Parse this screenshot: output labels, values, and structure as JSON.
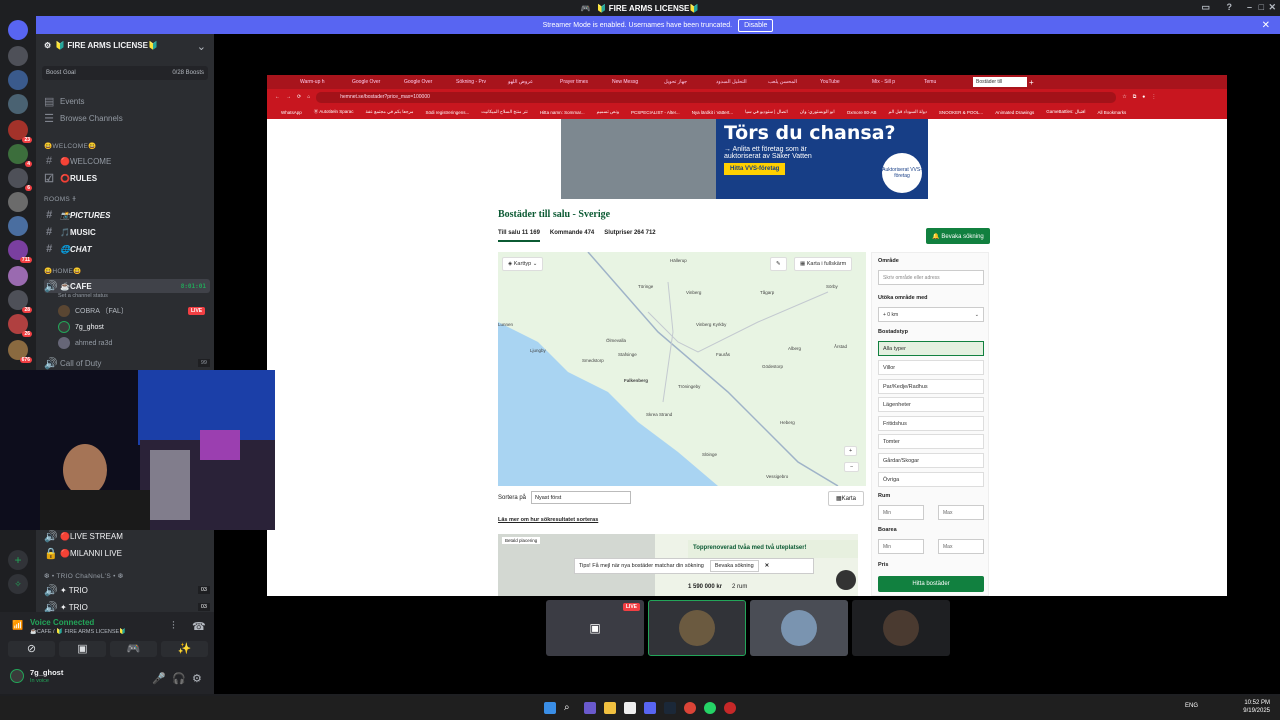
{
  "window": {
    "title": "🔰 FIRE ARMS LICENSE🔰"
  },
  "notice": {
    "text": "Streamer Mode is enabled. Usernames have been truncated.",
    "button": "Disable"
  },
  "rail": {
    "badges": [
      "23",
      "4",
      "6",
      "711",
      "676",
      "28",
      "26"
    ]
  },
  "sidebar": {
    "server_name": "🔰 FIRE ARMS LICENSE🔰",
    "boost_goal": "Boost Goal",
    "boosts": "0/28 Boosts",
    "events": "Events",
    "browse": "Browse Channels",
    "cat_welcome": "😃WELCOME😃",
    "welcome": "🔴WELCOME",
    "rules": "⭕RULES",
    "cat_rooms": "ROOMS 🕇",
    "pictures": "📸PICTURES",
    "music": "🎵MUSIC",
    "chat": "🌐CHAT",
    "cat_home": "😃HOME😃",
    "cafe": "☕CAFE",
    "cafe_time": "8:01:01",
    "cafe_status": "Set a channel status",
    "user1": "COBRA 〔FAL〕",
    "user1_badge": "LIVE",
    "user2": "7g_ghost",
    "user3": "ahmed ra3d",
    "callofduty": "Call of Duty",
    "callofduty_count": "99",
    "livestream": "🔴LIVE STREAM",
    "milanni": "🔴MILANNI LIVE",
    "cat_trio": "❆ • TRIO ChaNneL'S • ❆",
    "trio1": "✦ TRIO",
    "trio1_count": "03",
    "trio2": "✦ TRIO",
    "trio2_count": "03"
  },
  "voice": {
    "status": "Voice Connected",
    "location": "☕CAFE / 🔰 FIRE ARMS LICENSE🔰",
    "username": "7g_ghost",
    "substatus": "In voice"
  },
  "browser": {
    "tabs": [
      "Warm-up h",
      "Google Over",
      "Google Over",
      "Sökning - Prv",
      "عروض اللهو",
      "Prayer times",
      "New Messg",
      "جهاز تحويل",
      "التحليل السدود",
      "المحسن يلعب",
      "YouTube",
      "Mix - Sill p",
      "Temu",
      "Bostäder till"
    ],
    "url": "hemnet.se/bostader?price_max=100000",
    "bookmarks": [
      "WhatsApp",
      "Ⓡ Autotiteln Sparac",
      "مرجعا بكم في مجتمع عفة",
      "Södi registreringens...",
      "نتر منتخ السلاح الميكانيت",
      "Hitta namn: Sommar...",
      "ونص تسميم",
      "PCSPECIALIST - Alter...",
      "Nya lärdkit i Vattert...",
      "اتصال | ستوديو في سيا",
      "ابو الوبستوري: وان",
      "Oxmore 80-AB",
      "دولة السوداد قبل الم",
      "SNOOKER & POOL...",
      "Animated Drawings",
      "GameBattles: اقتبال",
      "All Bookmarks"
    ]
  },
  "ad": {
    "headline": "Törs du chansa?",
    "line1": "→ Anlita ett företag som är",
    "line2": "auktoriserat av Säker Vatten",
    "cta": "Hitta VVS-företag",
    "logo": "Auktoriserat VVS-företag"
  },
  "page": {
    "heading": "Bostäder till salu - Sverige",
    "tab_sale": "Till salu 11 169",
    "tab_coming": "Kommande 474",
    "tab_sold": "Slutpriser 264 712",
    "save_search": "🔔 Bevaka sökning",
    "map_type": "Karttyp",
    "map_fullscreen": "Karta i fullskärm",
    "sort_label": "Sortera på",
    "sort_value": "Nyast först",
    "map_button": "Karta",
    "learn_more": "Läs mer om hur sökresultatet sorteras",
    "card_tip": "Tips! Få mejl när nya bostäder matchar din sökning",
    "card_save": "Bevaka sökning",
    "card_promo": "Topprenoverad tvåa med två uteplatser!",
    "card_price": "1 590 000 kr",
    "card_rooms": "2 rum",
    "card_placement": "Betald placering"
  },
  "map": {
    "towns": [
      "Hällerup",
      "Töringe",
      "Vinberg",
      "Tågarp",
      "Sörby",
      "Lunnen",
      "Vinberg Kyrkby",
      "Ölmevalla",
      "Smedstorp",
      "Stafsinge",
      "Falkenberg",
      "Faurås",
      "Årstad",
      "Alberg",
      "Ljungby",
      "Tröningeby",
      "Skrea Strand",
      "Heberg",
      "Gödestorp",
      "Slöinge",
      "Vessigebro"
    ]
  },
  "filters": {
    "area_label": "Område",
    "area_placeholder": "Skriv område eller adress",
    "extend_label": "Utöka område med",
    "extend_value": "+ 0 km",
    "type_label": "Bostadstyp",
    "types": [
      "Alla typer",
      "Villor",
      "Par/Kedje/Radhus",
      "Lägenheter",
      "Fritidshus",
      "Tomter",
      "Gårdar/Skogar",
      "Övriga"
    ],
    "rooms_label": "Rum",
    "area2_label": "Boarea",
    "min": "Min",
    "max": "Max",
    "price_label": "Pris",
    "find_button": "Hitta bostäder"
  },
  "taskbar": {
    "lang": "ENG",
    "time": "10:52 PM",
    "date": "9/19/2025"
  }
}
